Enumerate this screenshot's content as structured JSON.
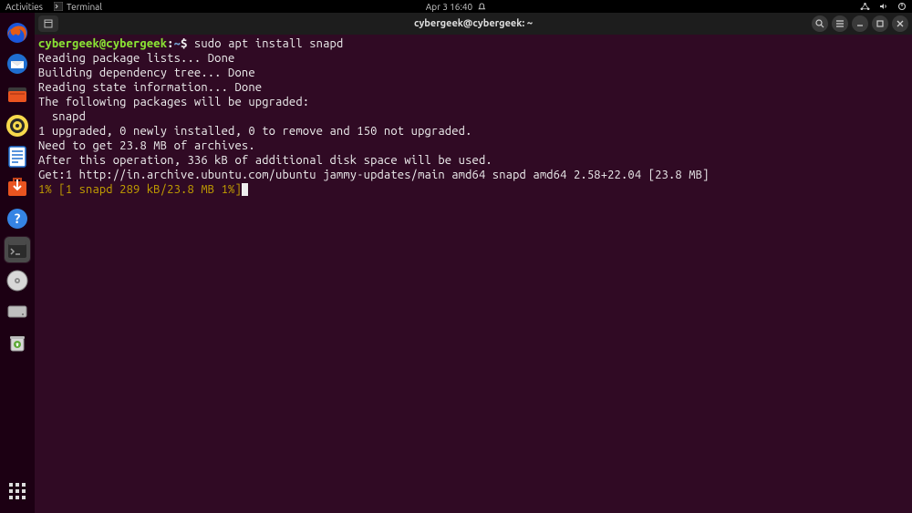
{
  "topbar": {
    "activities": "Activities",
    "app_name": "Terminal",
    "datetime": "Apr 3  16:40"
  },
  "window": {
    "title": "cybergeek@cybergeek: ~"
  },
  "terminal": {
    "prompt_user": "cybergeek@cybergeek",
    "prompt_colon": ":",
    "prompt_path": "~",
    "prompt_dollar": "$ ",
    "command": "sudo apt install snapd",
    "lines": [
      "Reading package lists... Done",
      "Building dependency tree... Done",
      "Reading state information... Done",
      "The following packages will be upgraded:",
      "  snapd",
      "1 upgraded, 0 newly installed, 0 to remove and 150 not upgraded.",
      "Need to get 23.8 MB of archives.",
      "After this operation, 336 kB of additional disk space will be used.",
      "Get:1 http://in.archive.ubuntu.com/ubuntu jammy-updates/main amd64 snapd amd64 2.58+22.04 [23.8 MB]"
    ],
    "progress": "1% [1 snapd 289 kB/23.8 MB 1%]"
  }
}
